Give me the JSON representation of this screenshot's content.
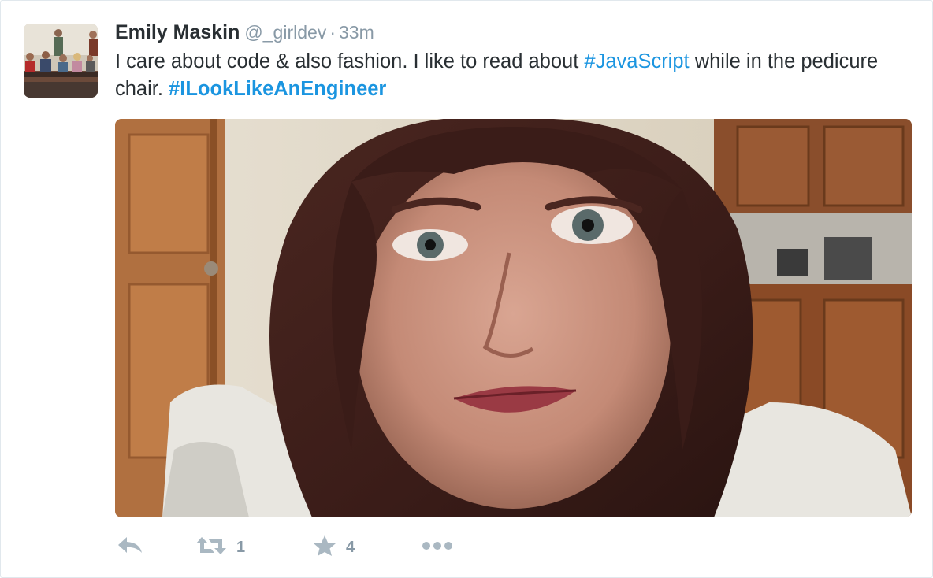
{
  "tweet": {
    "fullname": "Emily Maskin",
    "username": "@_girldev",
    "separator": "·",
    "time": "33m",
    "text_part1": "I care about code & also fashion. I like to read about ",
    "hashtag1": "#JavaScript",
    "text_part2": " while in the pedicure chair. ",
    "hashtag2": "#ILookLikeAnEngineer",
    "retweet_count": "1",
    "favorite_count": "4"
  },
  "icons": {
    "reply": "reply-icon",
    "retweet": "retweet-icon",
    "favorite": "star-icon",
    "more": "more-icon"
  },
  "colors": {
    "link": "#1b95e0",
    "text": "#292f33",
    "muted": "#8899a6",
    "icon": "#aab8c2"
  }
}
